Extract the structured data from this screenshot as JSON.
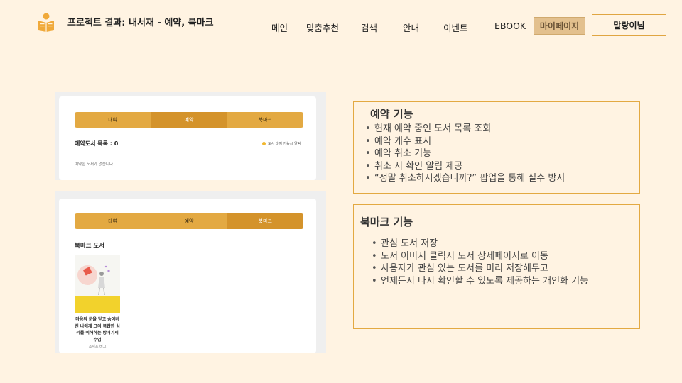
{
  "header": {
    "title": "프로젝트 결과: 내서재 - 예약, 북마크",
    "nav": [
      "메인",
      "맞춤추천",
      "검색",
      "안내",
      "이벤트",
      "EBOOK"
    ],
    "mypage": "마이페이지",
    "user_button": "말랑이님",
    "icon": "book-reader-icon"
  },
  "reservation_screen": {
    "tabs": [
      "대여",
      "예약",
      "북마크"
    ],
    "active_tab": "예약",
    "count_label": "예약도서 목록 : 0",
    "notify_label": "도서 대여 가능시 알림",
    "empty_message": "예약한 도서가 없습니다."
  },
  "bookmark_screen": {
    "tabs": [
      "대여",
      "예약",
      "북마크"
    ],
    "active_tab": "북마크",
    "title": "북마크 도서",
    "book": {
      "title_lines": [
        "마음의 문을 닫고 숨어버",
        "린 나에게 그의 복잡한 심",
        "리를 이해하는 방어기제",
        "수업"
      ],
      "author": "조지프 버고"
    }
  },
  "reservation_panel": {
    "title": "예약 기능",
    "items": [
      "현재 예약 중인 도서 목록 조회",
      "예약 개수 표시",
      "예약 취소 기능",
      "취소 시 확인 알림 제공",
      "“정말 취소하시겠습니까?” 팝업을 통해 실수 방지"
    ]
  },
  "bookmark_panel": {
    "title": "북마크 기능",
    "items": [
      "관심 도서 저장",
      "도서 이미지 클릭시 도서 상세페이지로 이동",
      "사용자가 관심 있는 도서를 미리 저장해두고",
      "언제든지 다시 확인할 수 있도록 제공하는 개인화 기능"
    ]
  },
  "colors": {
    "background": "#fff3e2",
    "accent": "#e3a942",
    "accent_dark": "#d4932b",
    "mypage_bg": "#e3c08e"
  }
}
